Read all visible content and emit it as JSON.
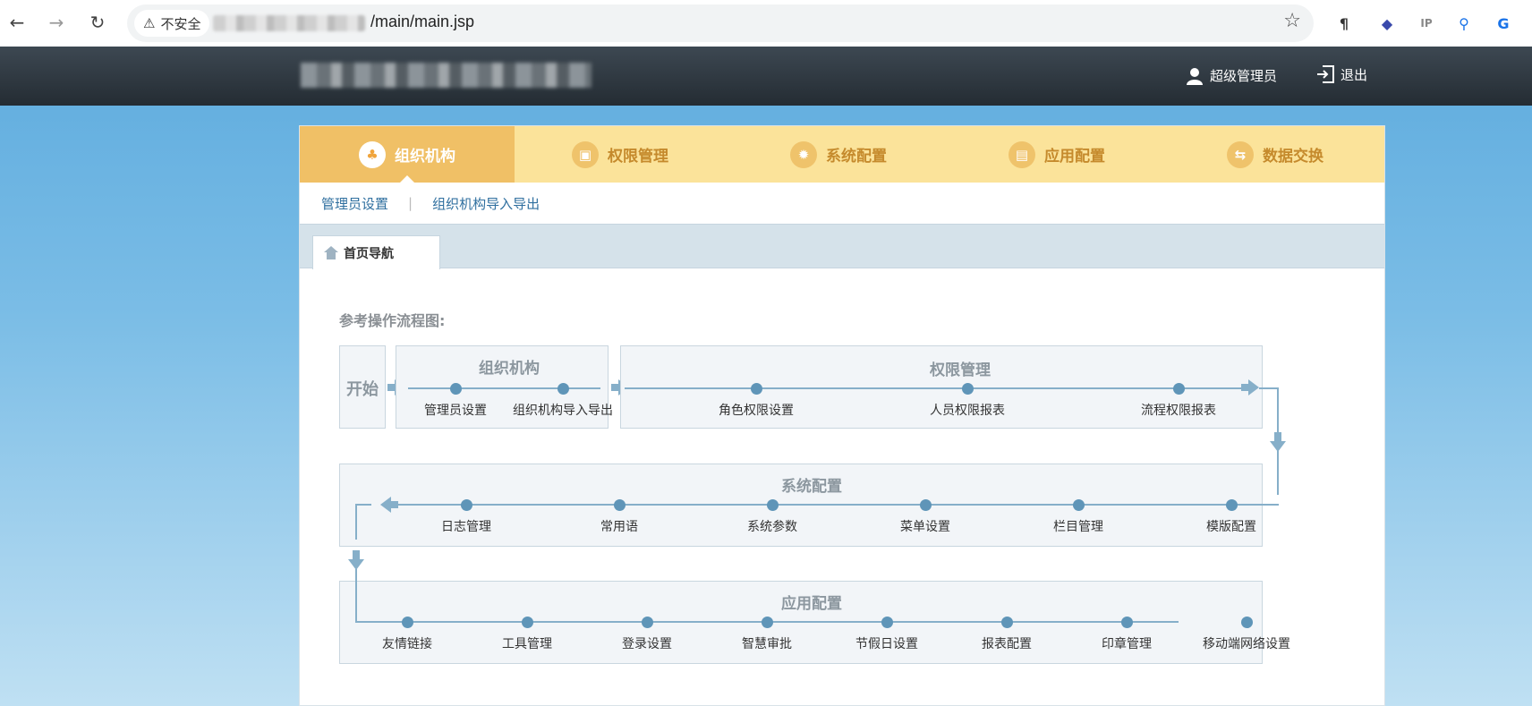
{
  "browser": {
    "security_label": "不安全",
    "url_visible": "/main/main.jsp"
  },
  "header": {
    "user_label": "超级管理员",
    "logout_label": "退出"
  },
  "tabs": [
    {
      "label": "组织机构",
      "icon": "tree-icon",
      "active": true
    },
    {
      "label": "权限管理",
      "icon": "lock-icon",
      "active": false
    },
    {
      "label": "系统配置",
      "icon": "gear-icon",
      "active": false
    },
    {
      "label": "应用配置",
      "icon": "app-icon",
      "active": false
    },
    {
      "label": "数据交换",
      "icon": "exchange-icon",
      "active": false
    }
  ],
  "subnav": [
    "管理员设置",
    "组织机构导入导出"
  ],
  "page_tab": {
    "label": "首页导航",
    "icon": "home-icon"
  },
  "flow": {
    "title": "参考操作流程图:",
    "start_label": "开始",
    "org": {
      "title": "组织机构",
      "items": [
        "管理员设置",
        "组织机构导入导出"
      ]
    },
    "perm": {
      "title": "权限管理",
      "items": [
        "角色权限设置",
        "人员权限报表",
        "流程权限报表"
      ]
    },
    "sys": {
      "title": "系统配置",
      "items": [
        "日志管理",
        "常用语",
        "系统参数",
        "菜单设置",
        "栏目管理",
        "模版配置"
      ]
    },
    "app": {
      "title": "应用配置",
      "items": [
        "友情链接",
        "工具管理",
        "登录设置",
        "智慧审批",
        "节假日设置",
        "报表配置",
        "印章管理",
        "移动端网络设置"
      ]
    }
  },
  "colors": {
    "accent": "#f0c066",
    "tab_bar": "#fbe39a",
    "flow_line": "#86afc9",
    "flow_dot": "#5f95b8"
  }
}
